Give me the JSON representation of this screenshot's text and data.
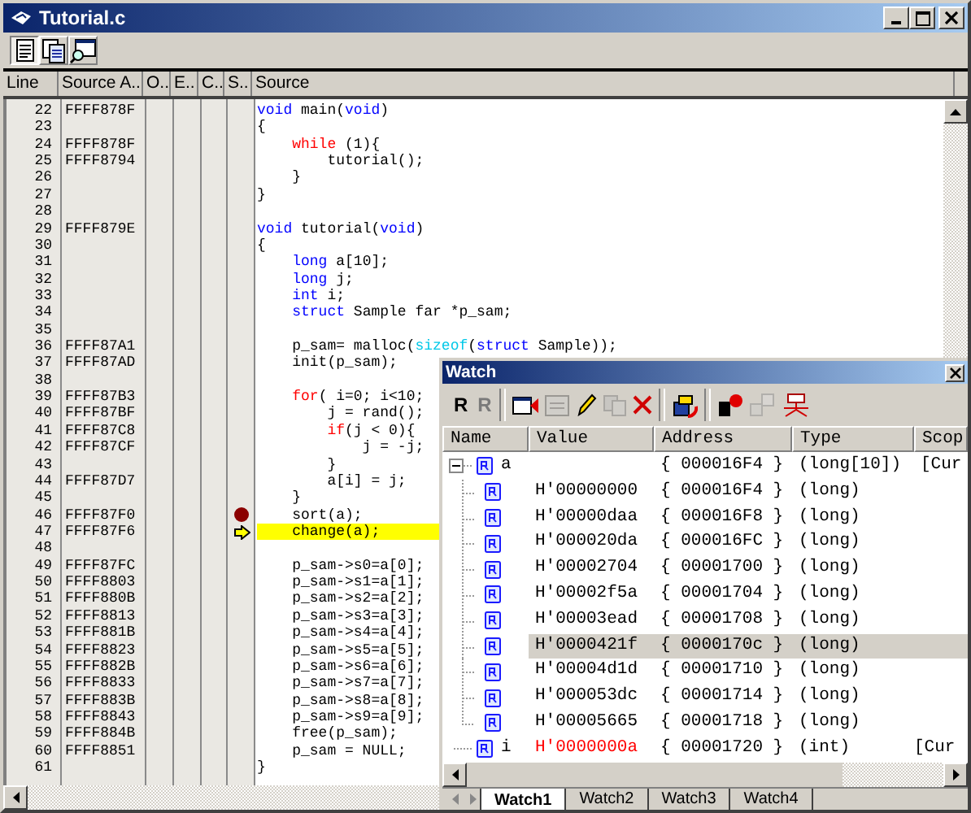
{
  "window": {
    "title": "Tutorial.c"
  },
  "toolbar": [
    {
      "kind": "source",
      "pressed": true
    },
    {
      "kind": "mixed",
      "pressed": false
    },
    {
      "kind": "disassembly",
      "pressed": false
    }
  ],
  "columns": [
    "Line",
    "Source A..",
    "O..",
    "E..",
    "C..",
    "S..",
    "Source"
  ],
  "rows": [
    {
      "line": "22",
      "address": "FFFF878F",
      "code": [
        {
          "text": "void",
          "kind": "type"
        },
        {
          "text": " main(",
          "kind": "plain"
        },
        {
          "text": "void",
          "kind": "type"
        },
        {
          "text": ")",
          "kind": "plain"
        }
      ],
      "breakpoint": false,
      "current": false
    },
    {
      "line": "23",
      "code": [
        {
          "text": "{",
          "kind": "plain"
        }
      ],
      "breakpoint": false,
      "current": false
    },
    {
      "line": "24",
      "address": "FFFF878F",
      "code": [
        {
          "text": "    while",
          "kind": "ctrl"
        },
        {
          "text": " (1){",
          "kind": "plain"
        }
      ],
      "breakpoint": false,
      "current": false
    },
    {
      "line": "25",
      "address": "FFFF8794",
      "code": [
        {
          "text": "        tutorial();",
          "kind": "plain"
        }
      ],
      "breakpoint": false,
      "current": false
    },
    {
      "line": "26",
      "code": [
        {
          "text": "    }",
          "kind": "plain"
        }
      ],
      "breakpoint": false,
      "current": false
    },
    {
      "line": "27",
      "code": [
        {
          "text": "}",
          "kind": "plain"
        }
      ],
      "breakpoint": false,
      "current": false
    },
    {
      "line": "28",
      "breakpoint": false,
      "current": false
    },
    {
      "line": "29",
      "address": "FFFF879E",
      "code": [
        {
          "text": "void",
          "kind": "type"
        },
        {
          "text": " tutorial(",
          "kind": "plain"
        },
        {
          "text": "void",
          "kind": "type"
        },
        {
          "text": ")",
          "kind": "plain"
        }
      ],
      "breakpoint": false,
      "current": false
    },
    {
      "line": "30",
      "code": [
        {
          "text": "{",
          "kind": "plain"
        }
      ],
      "breakpoint": false,
      "current": false
    },
    {
      "line": "31",
      "code": [
        {
          "text": "    long",
          "kind": "type"
        },
        {
          "text": " a[10];",
          "kind": "plain"
        }
      ],
      "breakpoint": false,
      "current": false
    },
    {
      "line": "32",
      "code": [
        {
          "text": "    long",
          "kind": "type"
        },
        {
          "text": " j;",
          "kind": "plain"
        }
      ],
      "breakpoint": false,
      "current": false
    },
    {
      "line": "33",
      "code": [
        {
          "text": "    int",
          "kind": "type"
        },
        {
          "text": " i;",
          "kind": "plain"
        }
      ],
      "breakpoint": false,
      "current": false
    },
    {
      "line": "34",
      "code": [
        {
          "text": "    struct",
          "kind": "type"
        },
        {
          "text": " Sample far *p_sam;",
          "kind": "plain"
        }
      ],
      "breakpoint": false,
      "current": false
    },
    {
      "line": "35",
      "breakpoint": false,
      "current": false
    },
    {
      "line": "36",
      "address": "FFFF87A1",
      "code": [
        {
          "text": "    p_sam= malloc(",
          "kind": "plain"
        },
        {
          "text": "sizeof",
          "kind": "fn"
        },
        {
          "text": "(",
          "kind": "plain"
        },
        {
          "text": "struct",
          "kind": "type"
        },
        {
          "text": " Sample));",
          "kind": "plain"
        }
      ],
      "breakpoint": false,
      "current": false
    },
    {
      "line": "37",
      "address": "FFFF87AD",
      "code": [
        {
          "text": "    init(p_sam);",
          "kind": "plain"
        }
      ],
      "breakpoint": false,
      "current": false
    },
    {
      "line": "38",
      "breakpoint": false,
      "current": false
    },
    {
      "line": "39",
      "address": "FFFF87B3",
      "code": [
        {
          "text": "    for",
          "kind": "ctrl"
        },
        {
          "text": "( i=0; i<10;",
          "kind": "plain"
        }
      ],
      "breakpoint": false,
      "current": false
    },
    {
      "line": "40",
      "address": "FFFF87BF",
      "code": [
        {
          "text": "        j = rand();",
          "kind": "plain"
        }
      ],
      "breakpoint": false,
      "current": false
    },
    {
      "line": "41",
      "address": "FFFF87C8",
      "code": [
        {
          "text": "        if",
          "kind": "ctrl"
        },
        {
          "text": "(j < 0){",
          "kind": "plain"
        }
      ],
      "breakpoint": false,
      "current": false
    },
    {
      "line": "42",
      "address": "FFFF87CF",
      "code": [
        {
          "text": "            j = -j;",
          "kind": "plain"
        }
      ],
      "breakpoint": false,
      "current": false
    },
    {
      "line": "43",
      "code": [
        {
          "text": "        }",
          "kind": "plain"
        }
      ],
      "breakpoint": false,
      "current": false
    },
    {
      "line": "44",
      "address": "FFFF87D7",
      "code": [
        {
          "text": "        a[i] = j;",
          "kind": "plain"
        }
      ],
      "breakpoint": false,
      "current": false
    },
    {
      "line": "45",
      "code": [
        {
          "text": "    }",
          "kind": "plain"
        }
      ],
      "breakpoint": false,
      "current": false
    },
    {
      "line": "46",
      "address": "FFFF87F0",
      "code": [
        {
          "text": "    sort(a);",
          "kind": "plain"
        }
      ],
      "breakpoint": true,
      "current": false
    },
    {
      "line": "47",
      "address": "FFFF87F6",
      "code": [
        {
          "text": "    change(a);",
          "kind": "plain"
        }
      ],
      "breakpoint": false,
      "current": true
    },
    {
      "line": "48",
      "breakpoint": false,
      "current": false
    },
    {
      "line": "49",
      "address": "FFFF87FC",
      "code": [
        {
          "text": "    p_sam->s0=a[0];",
          "kind": "plain"
        }
      ],
      "breakpoint": false,
      "current": false
    },
    {
      "line": "50",
      "address": "FFFF8803",
      "code": [
        {
          "text": "    p_sam->s1=a[1];",
          "kind": "plain"
        }
      ],
      "breakpoint": false,
      "current": false
    },
    {
      "line": "51",
      "address": "FFFF880B",
      "code": [
        {
          "text": "    p_sam->s2=a[2];",
          "kind": "plain"
        }
      ],
      "breakpoint": false,
      "current": false
    },
    {
      "line": "52",
      "address": "FFFF8813",
      "code": [
        {
          "text": "    p_sam->s3=a[3];",
          "kind": "plain"
        }
      ],
      "breakpoint": false,
      "current": false
    },
    {
      "line": "53",
      "address": "FFFF881B",
      "code": [
        {
          "text": "    p_sam->s4=a[4];",
          "kind": "plain"
        }
      ],
      "breakpoint": false,
      "current": false
    },
    {
      "line": "54",
      "address": "FFFF8823",
      "code": [
        {
          "text": "    p_sam->s5=a[5];",
          "kind": "plain"
        }
      ],
      "breakpoint": false,
      "current": false
    },
    {
      "line": "55",
      "address": "FFFF882B",
      "code": [
        {
          "text": "    p_sam->s6=a[6];",
          "kind": "plain"
        }
      ],
      "breakpoint": false,
      "current": false
    },
    {
      "line": "56",
      "address": "FFFF8833",
      "code": [
        {
          "text": "    p_sam->s7=a[7];",
          "kind": "plain"
        }
      ],
      "breakpoint": false,
      "current": false
    },
    {
      "line": "57",
      "address": "FFFF883B",
      "code": [
        {
          "text": "    p_sam->s8=a[8];",
          "kind": "plain"
        }
      ],
      "breakpoint": false,
      "current": false
    },
    {
      "line": "58",
      "address": "FFFF8843",
      "code": [
        {
          "text": "    p_sam->s9=a[9];",
          "kind": "plain"
        }
      ],
      "breakpoint": false,
      "current": false
    },
    {
      "line": "59",
      "address": "FFFF884B",
      "code": [
        {
          "text": "    free(p_sam);",
          "kind": "plain"
        }
      ],
      "breakpoint": false,
      "current": false
    },
    {
      "line": "60",
      "address": "FFFF8851",
      "code": [
        {
          "text": "    p_sam = NULL;",
          "kind": "plain"
        }
      ],
      "breakpoint": false,
      "current": false
    },
    {
      "line": "61",
      "code": [
        {
          "text": "}",
          "kind": "plain"
        }
      ],
      "breakpoint": false,
      "current": false
    }
  ],
  "watch": {
    "title": "Watch",
    "tools": [
      {
        "kind": "text",
        "label": "R",
        "disabled": false
      },
      {
        "kind": "text",
        "label": "R",
        "disabled": true
      },
      {
        "kind": "separator"
      },
      {
        "kind": "window",
        "disabled": false
      },
      {
        "kind": "grid",
        "disabled": true
      },
      {
        "kind": "pencil",
        "disabled": false
      },
      {
        "kind": "copy",
        "disabled": true
      },
      {
        "kind": "delete",
        "disabled": false
      },
      {
        "kind": "separator"
      },
      {
        "kind": "refresh",
        "disabled": false
      },
      {
        "kind": "separator"
      },
      {
        "kind": "record",
        "disabled": false
      },
      {
        "kind": "link",
        "disabled": true
      },
      {
        "kind": "scan",
        "disabled": false
      }
    ],
    "columns": [
      "Name",
      "Value",
      "Address",
      "Type",
      "Scop"
    ],
    "rows": [
      {
        "name": "a",
        "address": "{ 000016F4 }",
        "type": "(long[10])",
        "scope": "[Cur",
        "expanded": true,
        "selected": false,
        "children": [
          {
            "value": "H'00000000",
            "address": "{ 000016F4 }",
            "type": "(long)",
            "selected": false,
            "changed": false
          },
          {
            "value": "H'00000daa",
            "address": "{ 000016F8 }",
            "type": "(long)",
            "selected": false,
            "changed": false
          },
          {
            "value": "H'000020da",
            "address": "{ 000016FC }",
            "type": "(long)",
            "selected": false,
            "changed": false
          },
          {
            "value": "H'00002704",
            "address": "{ 00001700 }",
            "type": "(long)",
            "selected": false,
            "changed": false
          },
          {
            "value": "H'00002f5a",
            "address": "{ 00001704 }",
            "type": "(long)",
            "selected": false,
            "changed": false
          },
          {
            "value": "H'00003ead",
            "address": "{ 00001708 }",
            "type": "(long)",
            "selected": false,
            "changed": false
          },
          {
            "value": "H'0000421f",
            "address": "{ 0000170c }",
            "type": "(long)",
            "selected": true,
            "changed": false
          },
          {
            "value": "H'00004d1d",
            "address": "{ 00001710 }",
            "type": "(long)",
            "selected": false,
            "changed": false
          },
          {
            "value": "H'000053dc",
            "address": "{ 00001714 }",
            "type": "(long)",
            "selected": false,
            "changed": false
          },
          {
            "value": "H'00005665",
            "address": "{ 00001718 }",
            "type": "(long)",
            "selected": false,
            "changed": false
          }
        ]
      },
      {
        "name": "i",
        "value": "H'0000000a",
        "address": "{ 00001720 }",
        "type": "(int)",
        "scope": "[Cur",
        "selected": false,
        "changed": true
      }
    ],
    "tabs": [
      {
        "label": "Watch1",
        "selected": true
      },
      {
        "label": "Watch2",
        "selected": false
      },
      {
        "label": "Watch3",
        "selected": false
      },
      {
        "label": "Watch4",
        "selected": false
      }
    ]
  }
}
